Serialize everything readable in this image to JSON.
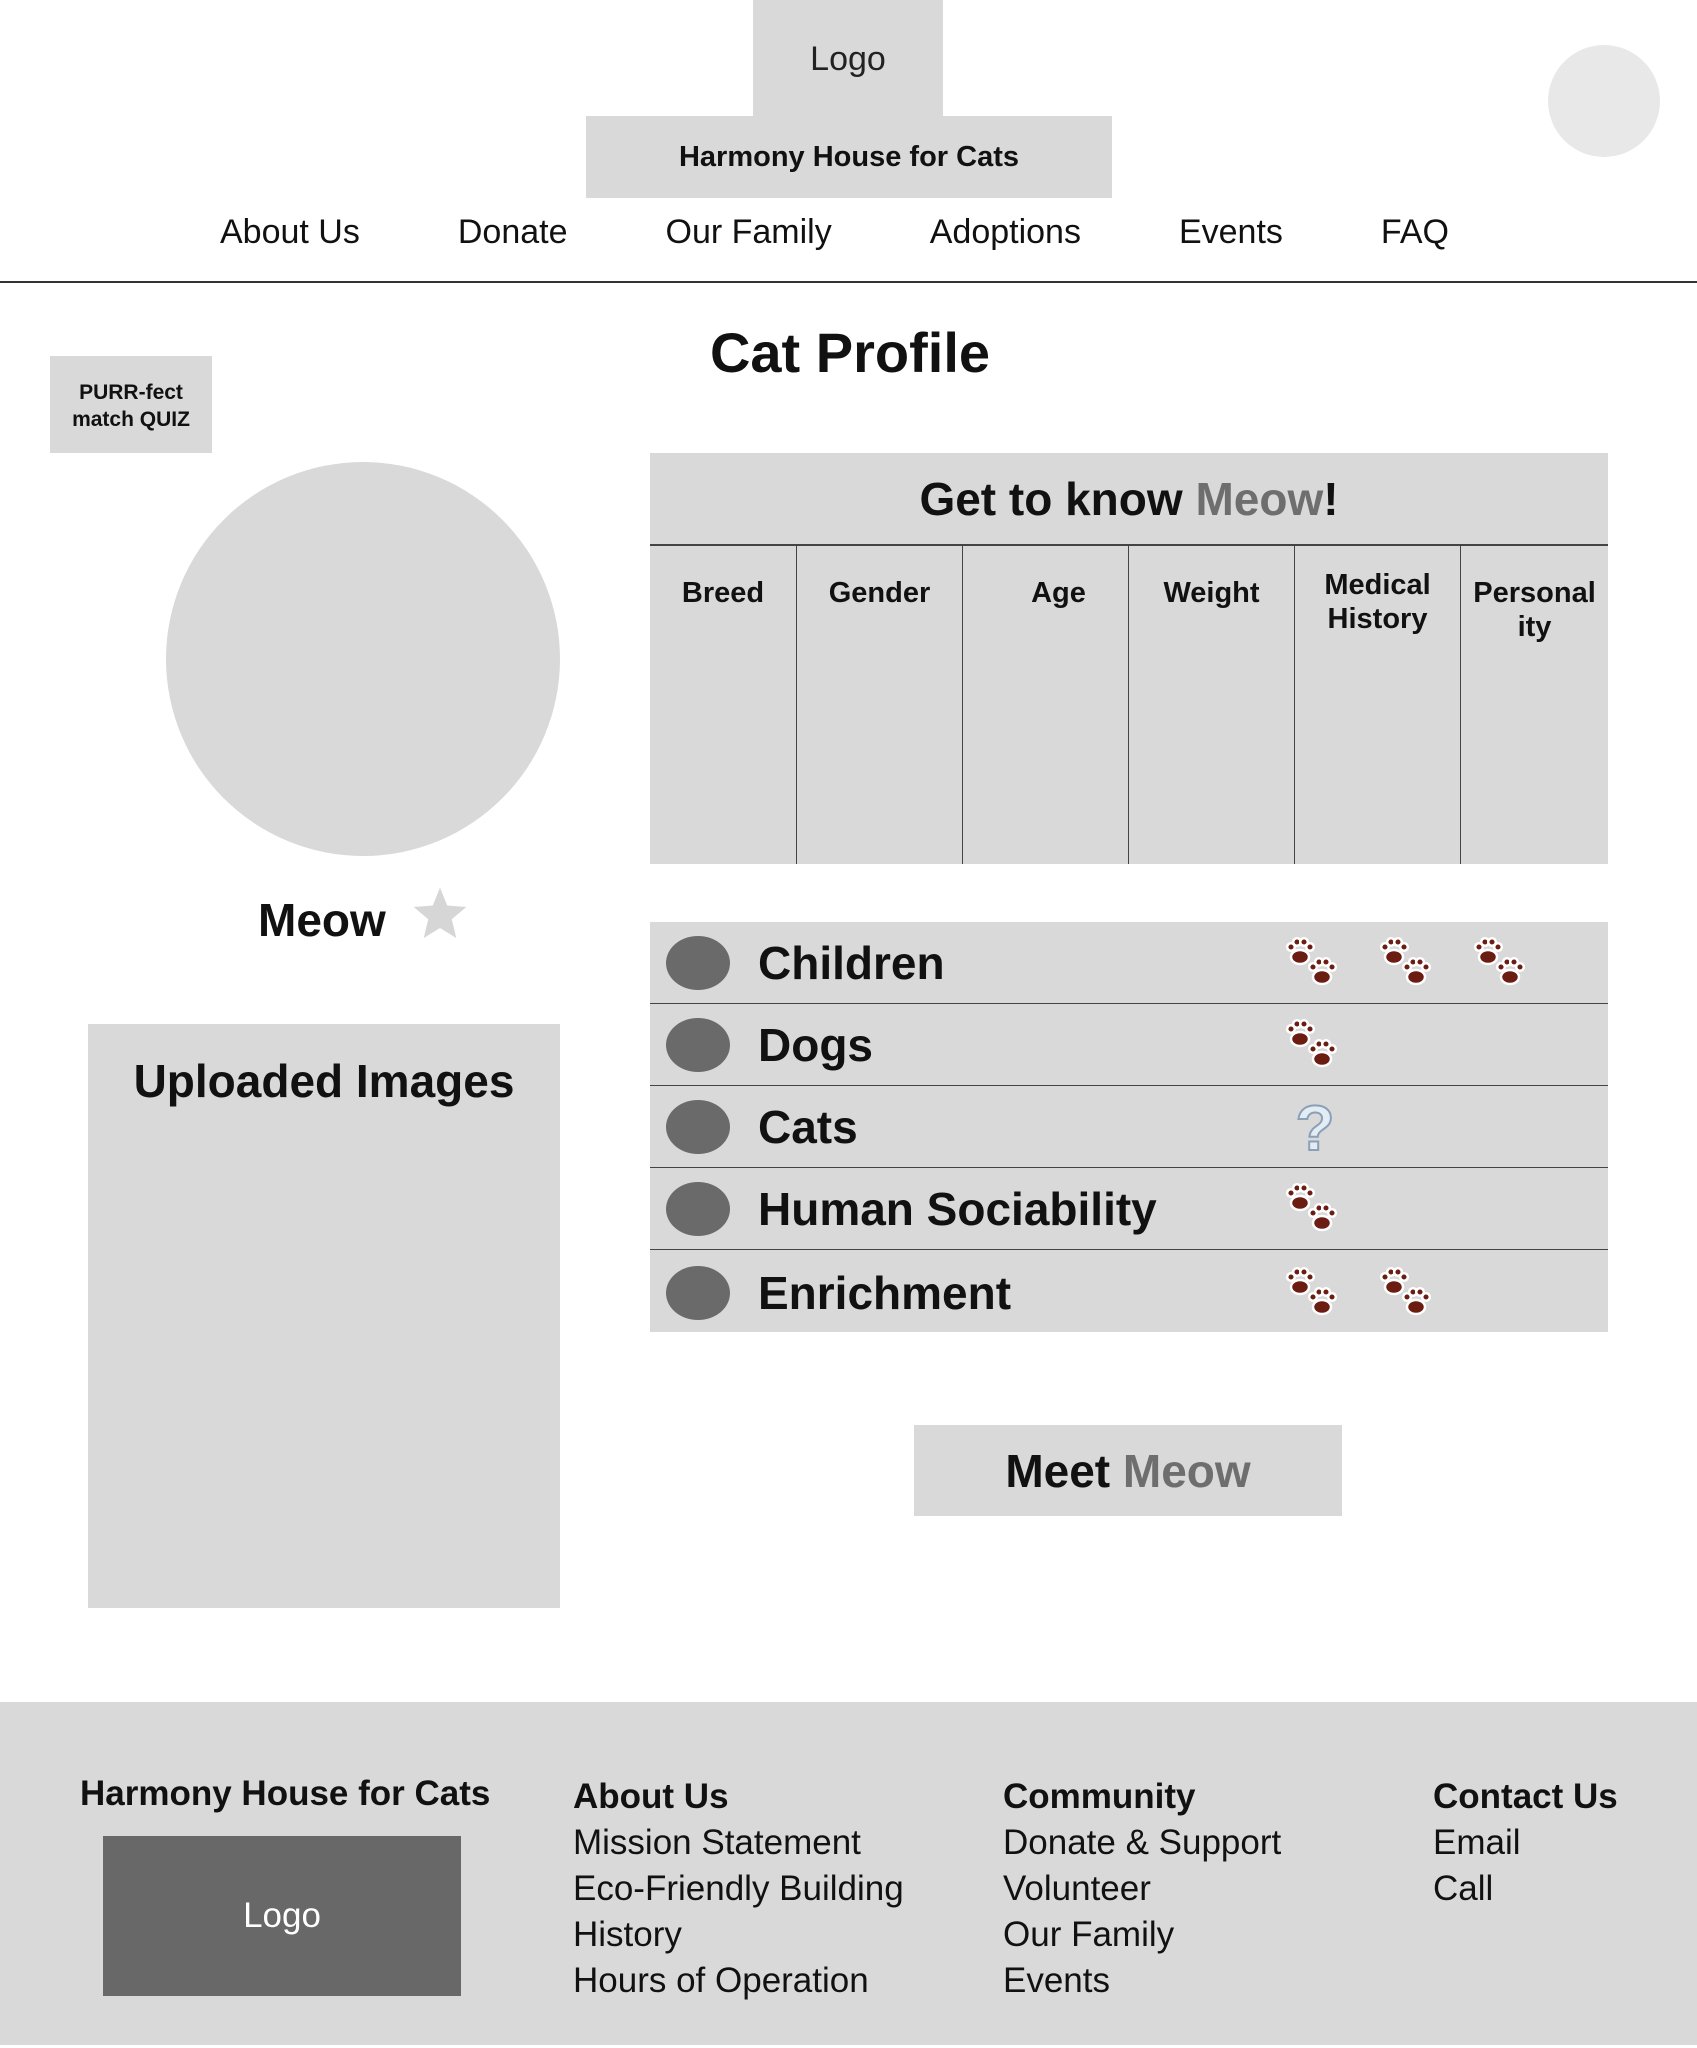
{
  "header": {
    "logo": "Logo",
    "brand": "Harmony House for Cats",
    "nav": [
      "About Us",
      "Donate",
      "Our Family",
      "Adoptions",
      "Events",
      "FAQ"
    ]
  },
  "page": {
    "title": "Cat Profile",
    "quiz_button": "PURR-fect match QUIZ",
    "cat_name": "Meow",
    "uploads_title": "Uploaded Images"
  },
  "get_to_know": {
    "prefix": "Get to know ",
    "name": "Meow",
    "suffix": "!",
    "columns": [
      "Breed",
      "Gender",
      "Age",
      "Weight",
      "Medical History",
      "Personal ity"
    ]
  },
  "compatibility": [
    {
      "label": "Children",
      "rating": 3,
      "icon": "paw-icon"
    },
    {
      "label": "Dogs",
      "rating": 1,
      "icon": "paw-icon"
    },
    {
      "label": "Cats",
      "rating": 0,
      "icon": "question-icon"
    },
    {
      "label": "Human Sociability",
      "rating": 1,
      "icon": "paw-icon"
    },
    {
      "label": "Enrichment",
      "rating": 2,
      "icon": "paw-icon"
    }
  ],
  "meet_button": {
    "prefix": "Meet ",
    "name": "Meow"
  },
  "footer": {
    "brand": "Harmony House for Cats",
    "logo": "Logo",
    "columns": [
      {
        "heading": "About Us",
        "links": [
          "Mission Statement",
          "Eco-Friendly Building",
          "History",
          "Hours of Operation"
        ]
      },
      {
        "heading": "Community",
        "links": [
          "Donate & Support",
          "Volunteer",
          "Our Family",
          "Events"
        ]
      },
      {
        "heading": "Contact Us",
        "links": [
          "Email",
          "Call"
        ]
      }
    ]
  },
  "colors": {
    "panel": "#d9d9d9",
    "muted_text": "#6e6e6e",
    "paw": "#6b1d12",
    "dot": "#6a6a6a"
  }
}
